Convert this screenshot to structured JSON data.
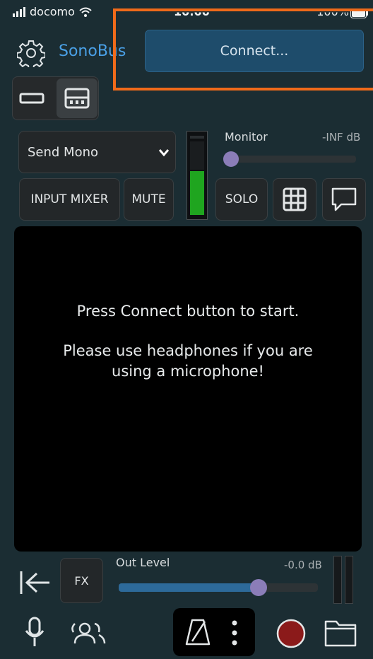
{
  "status_bar": {
    "carrier": "docomo",
    "time": "10:00",
    "battery": "100%"
  },
  "header": {
    "app_name": "SonoBus",
    "connect_label": "Connect..."
  },
  "send": {
    "mode": "Send Mono"
  },
  "buttons": {
    "input_mixer": "INPUT MIXER",
    "mute": "MUTE",
    "solo": "SOLO",
    "fx": "FX"
  },
  "monitor": {
    "label": "Monitor",
    "db": "-INF dB",
    "level": 0.0
  },
  "message": {
    "line1": "Press Connect button to start.",
    "line2": "Please use headphones if you are",
    "line3": "using a microphone!"
  },
  "out_level": {
    "label": "Out Level",
    "db": "-0.0 dB",
    "level": 0.72
  },
  "colors": {
    "accent": "#4aa0e6",
    "connect_bg": "#1e4c6b",
    "highlight": "#f06a1a",
    "meter_green": "#1fa51f",
    "record": "#8b1a1a"
  },
  "icons": [
    "gear-icon",
    "single-layout-icon",
    "multi-layout-icon",
    "chevron-down-icon",
    "grid-icon",
    "chat-icon",
    "back-to-start-icon",
    "microphone-icon",
    "people-icon",
    "metronome-icon",
    "more-vertical-icon",
    "record-icon",
    "folder-icon"
  ]
}
